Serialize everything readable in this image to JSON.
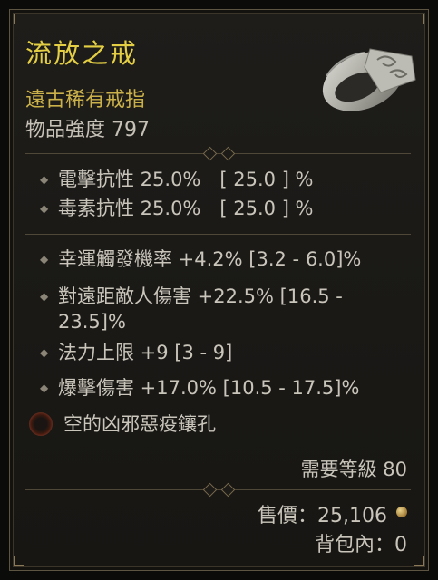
{
  "item": {
    "name": "流放之戒",
    "rarity": "遠古稀有戒指",
    "item_power_label": "物品強度 797"
  },
  "implicit_stats": [
    {
      "text": "電擊抗性 25.0%　[ 25.0 ] %"
    },
    {
      "text": "毒素抗性 25.0%　[ 25.0 ] %"
    }
  ],
  "affixes": [
    {
      "text": "幸運觸發機率 +4.2% [3.2 - 6.0]%"
    },
    {
      "line1": "對遠距敵人傷害 +22.5% [16.5 -",
      "line2": "23.5]%"
    },
    {
      "text": "法力上限 +9 [3 - 9]"
    },
    {
      "text": "爆擊傷害 +17.0% [10.5 - 17.5]%"
    }
  ],
  "socket": {
    "text": "空的凶邪惡疫鑲孔"
  },
  "requirement": "需要等級 80",
  "sell_value": "售價：25,106",
  "bag": "背包內：0",
  "colors": {
    "title": "#e4cf44",
    "rarity": "#cbb14a",
    "text": "#c9c5bb",
    "border": "#5e5442"
  },
  "icons": {
    "ring": "ring-icon",
    "bullet": "diamond-bullet-icon",
    "socket": "empty-socket-icon",
    "gold": "gold-coin-icon"
  }
}
